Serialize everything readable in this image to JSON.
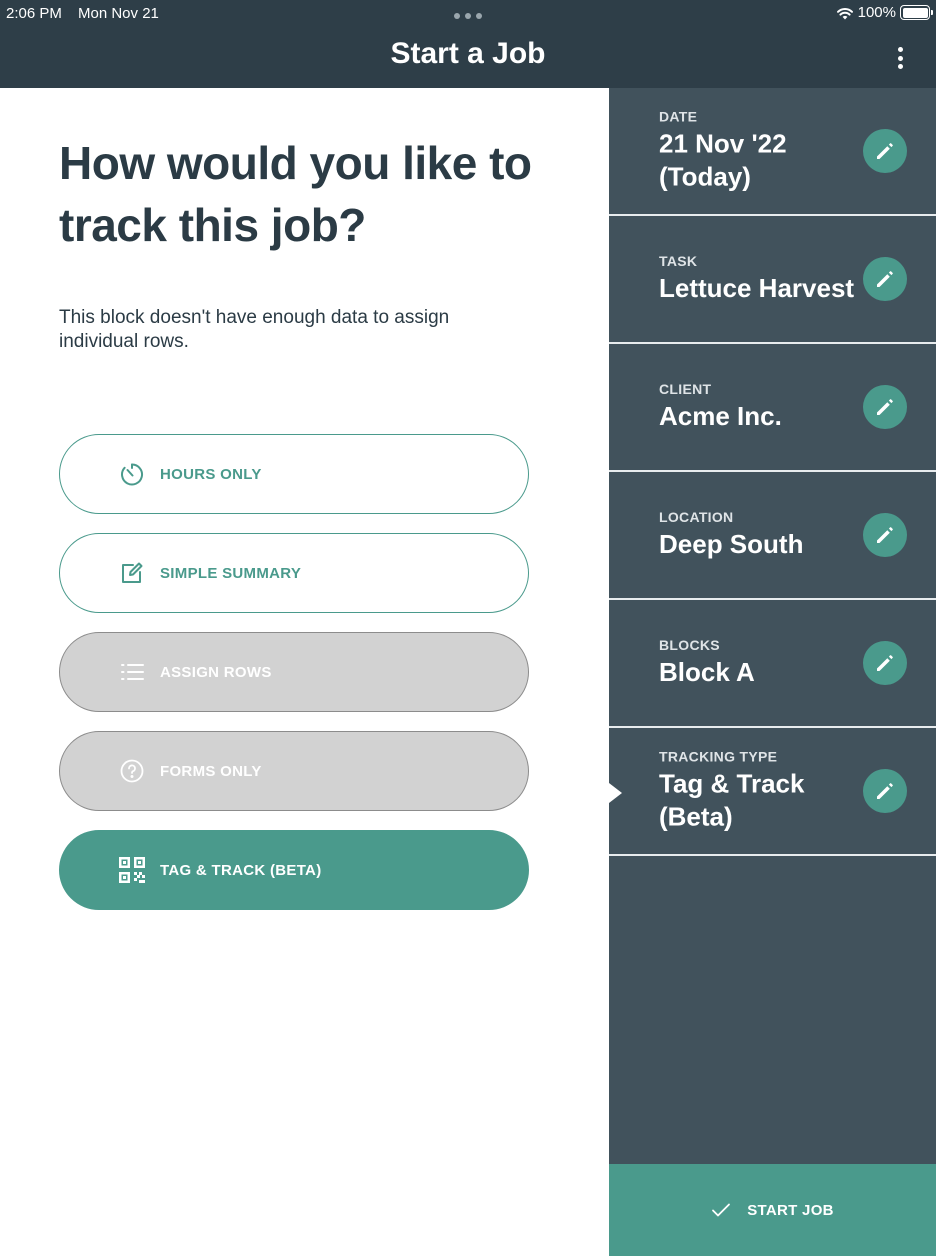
{
  "status_bar": {
    "time": "2:06 PM",
    "date": "Mon Nov 21",
    "battery": "100%"
  },
  "nav": {
    "title": "Start a Job"
  },
  "main": {
    "heading": "How would you like to track this job?",
    "subtext": "This block doesn't have enough data to assign individual rows.",
    "options": [
      {
        "label": "HOURS ONLY",
        "icon": "stopwatch-icon",
        "state": "outline"
      },
      {
        "label": "SIMPLE SUMMARY",
        "icon": "edit-note-icon",
        "state": "outline"
      },
      {
        "label": "ASSIGN ROWS",
        "icon": "list-icon",
        "state": "disabled"
      },
      {
        "label": "FORMS ONLY",
        "icon": "help-circle-icon",
        "state": "disabled"
      },
      {
        "label": "TAG & TRACK (BETA)",
        "icon": "qr-code-icon",
        "state": "selected"
      }
    ]
  },
  "summary": [
    {
      "caption": "DATE",
      "value": "21 Nov '22 (Today)"
    },
    {
      "caption": "TASK",
      "value": "Lettuce Harvest"
    },
    {
      "caption": "CLIENT",
      "value": "Acme Inc."
    },
    {
      "caption": "LOCATION",
      "value": "Deep South"
    },
    {
      "caption": "BLOCKS",
      "value": "Block A"
    },
    {
      "caption": "TRACKING TYPE",
      "value": "Tag & Track (Beta)"
    }
  ],
  "start_button": {
    "label": "START JOB"
  },
  "colors": {
    "header": "#2e3e48",
    "panel": "#41525c",
    "accent": "#4a9a8c",
    "disabled": "#d2d2d2",
    "text": "#2b3b45"
  }
}
